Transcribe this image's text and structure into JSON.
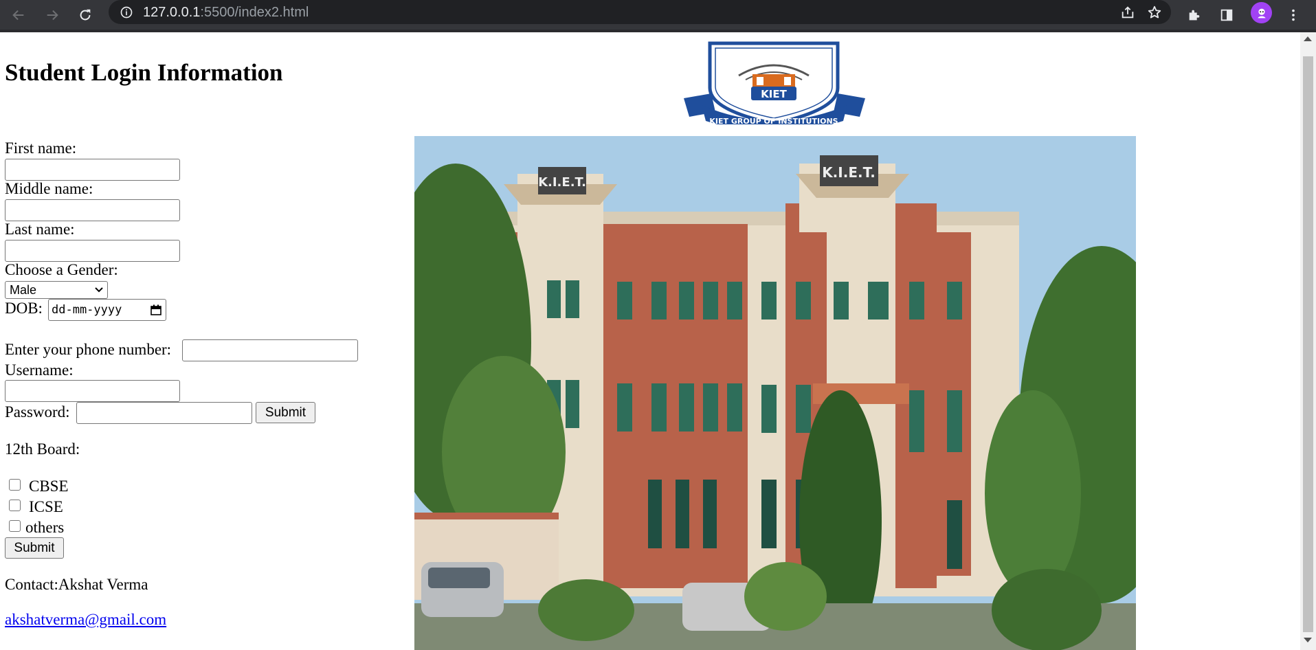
{
  "browser": {
    "url_host": "127.0.0.1",
    "url_path": ":5500/index2.html"
  },
  "page": {
    "title": "Student Login Information",
    "first_name_label": "First name:",
    "middle_name_label": "Middle name:",
    "last_name_label": "Last name:",
    "gender_label": "Choose a Gender:",
    "gender_selected": "Male",
    "dob_label": "DOB:",
    "dob_placeholder": "dd-mm-yyyy",
    "phone_label": "Enter your phone number:",
    "username_label": "Username:",
    "password_label": "Password:",
    "password_submit": "Submit",
    "board_label": "12th Board:",
    "board_options": [
      "CBSE",
      "ICSE",
      "others"
    ],
    "submit_label": "Submit",
    "contact": "Contact:Akshat Verma",
    "email": "akshatverma@gmail.com"
  },
  "logo": {
    "banner_text": "KIET GROUP OF INSTITUTIONS",
    "shield_text": "KIET"
  },
  "photo": {
    "building_sign_left": "K.I.E.T.",
    "building_sign_right": "K.I.E.T."
  },
  "colors": {
    "logo_blue": "#1f4e9c",
    "link": "#0000ee"
  }
}
